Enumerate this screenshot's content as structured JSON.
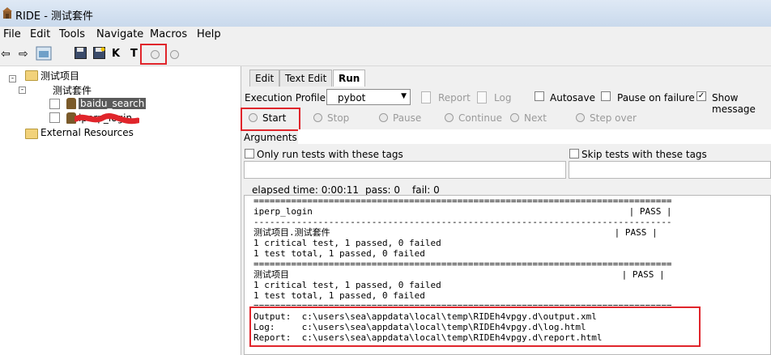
{
  "window": {
    "title": "RIDE - 测试套件"
  },
  "menu": [
    "File",
    "Edit",
    "Tools",
    "Navigate",
    "Macros",
    "Help"
  ],
  "tree": {
    "project": "测试项目",
    "suite": "测试套件",
    "test1": "baidu_search",
    "test2": "iperp_login",
    "external": "External Resources"
  },
  "tabs": [
    "Edit",
    "Text Edit",
    "Run"
  ],
  "run": {
    "profile_label": "Execution Profile:",
    "profile_value": "pybot",
    "report": "Report",
    "log": "Log",
    "autosave": "Autosave",
    "pause_on_failure": "Pause on failure",
    "show_message": "Show message",
    "buttons": [
      "Start",
      "Stop",
      "Pause",
      "Continue",
      "Next",
      "Step over"
    ],
    "arguments_label": "Arguments:",
    "only_run_tags": "Only run tests with these tags",
    "skip_tags": "Skip tests with these tags",
    "elapsed": "elapsed time: 0:00:11",
    "pass": "pass: 0",
    "fail": "fail: 0"
  },
  "output": {
    "lines": [
      "==============================================================================",
      "iperp_login                                                           | PASS |",
      "------------------------------------------------------------------------------",
      "测试项目.测试套件                                                     | PASS |",
      "1 critical test, 1 passed, 0 failed",
      "1 test total, 1 passed, 0 failed",
      "==============================================================================",
      "测试项目                                                              | PASS |",
      "1 critical test, 1 passed, 0 failed",
      "1 test total, 1 passed, 0 failed",
      "==============================================================================",
      "Output:  c:\\users\\sea\\appdata\\local\\temp\\RIDEh4vpgy.d\\output.xml",
      "Log:     c:\\users\\sea\\appdata\\local\\temp\\RIDEh4vpgy.d\\log.html",
      "Report:  c:\\users\\sea\\appdata\\local\\temp\\RIDEh4vpgy.d\\report.html"
    ]
  },
  "colors": {
    "highlight_red": "#e0252b",
    "titlebar": "#dfe9f5"
  }
}
